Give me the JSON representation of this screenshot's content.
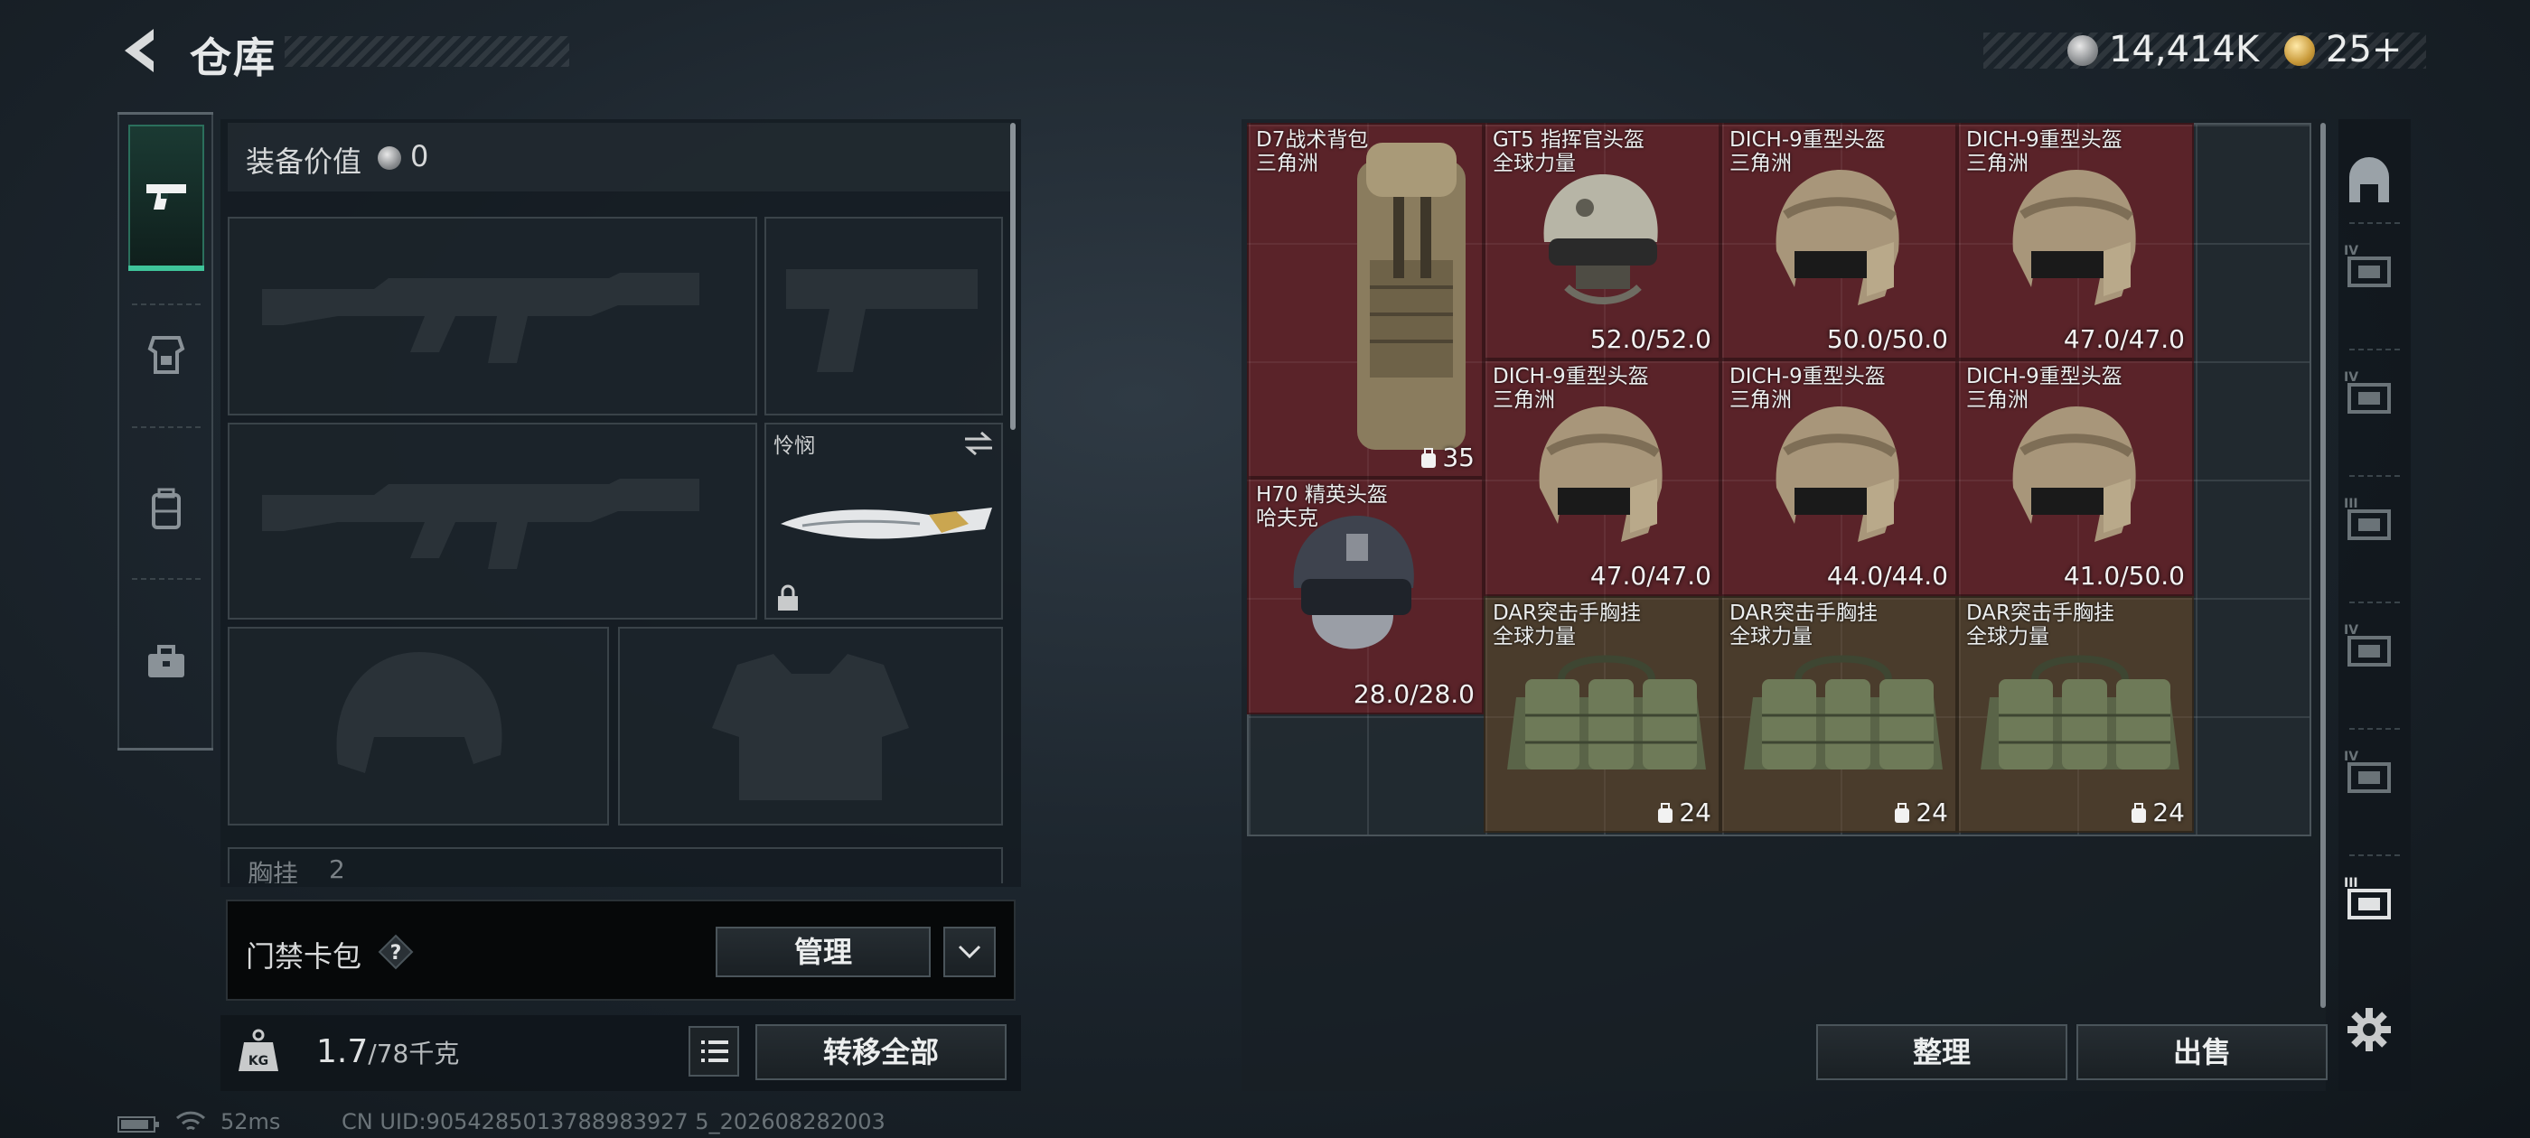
{
  "header": {
    "title": "仓库"
  },
  "currency": {
    "silver": "14,414K",
    "gold": "25+"
  },
  "equipment": {
    "value_label": "装备价值",
    "value": "0",
    "melee_name": "怜悯",
    "chest_rig_partial": "胸挂",
    "chest_rig_partial_count": "2"
  },
  "card_pack": {
    "label": "门禁卡包",
    "help": "?",
    "manage": "管理"
  },
  "weight": {
    "current": "1.7",
    "max": "/78千克"
  },
  "buttons": {
    "transfer_all": "转移全部",
    "sort": "整理",
    "sell": "出售"
  },
  "status": {
    "ping": "52ms",
    "uid": "CN UID:9054285013788983927 5_202608282003"
  },
  "stash_items": [
    {
      "name": "D7战术背包",
      "sub": "三角洲",
      "capacity": "35",
      "color": "red",
      "type": "backpack"
    },
    {
      "name": "GT5 指挥官头盔",
      "sub": "全球力量",
      "durability": "52.0/52.0",
      "color": "red",
      "type": "helmet-gt5"
    },
    {
      "name": "DICH-9重型头盔",
      "sub": "三角洲",
      "durability": "50.0/50.0",
      "color": "red",
      "type": "helmet"
    },
    {
      "name": "DICH-9重型头盔",
      "sub": "三角洲",
      "durability": "47.0/47.0",
      "color": "red",
      "type": "helmet"
    },
    {
      "name": "DICH-9重型头盔",
      "sub": "三角洲",
      "durability": "47.0/47.0",
      "color": "red",
      "type": "helmet"
    },
    {
      "name": "DICH-9重型头盔",
      "sub": "三角洲",
      "durability": "44.0/44.0",
      "color": "red",
      "type": "helmet"
    },
    {
      "name": "DICH-9重型头盔",
      "sub": "三角洲",
      "durability": "41.0/50.0",
      "color": "red",
      "type": "helmet"
    },
    {
      "name": "H70 精英头盔",
      "sub": "哈夫克",
      "durability": "28.0/28.0",
      "color": "red",
      "type": "helmet-h70"
    },
    {
      "name": "DAR突击手胸挂",
      "sub": "全球力量",
      "capacity": "24",
      "color": "brown",
      "type": "rig"
    },
    {
      "name": "DAR突击手胸挂",
      "sub": "全球力量",
      "capacity": "24",
      "color": "brown",
      "type": "rig"
    },
    {
      "name": "DAR突击手胸挂",
      "sub": "全球力量",
      "capacity": "24",
      "color": "brown",
      "type": "rig"
    }
  ],
  "right_sidebar": {
    "tiers": [
      "IV",
      "IV",
      "III",
      "IV",
      "IV",
      "III"
    ]
  },
  "colors": {
    "rarity_red": "#5a2329",
    "rarity_brown": "#4a3c2c",
    "accent_green": "#3fc49a"
  }
}
